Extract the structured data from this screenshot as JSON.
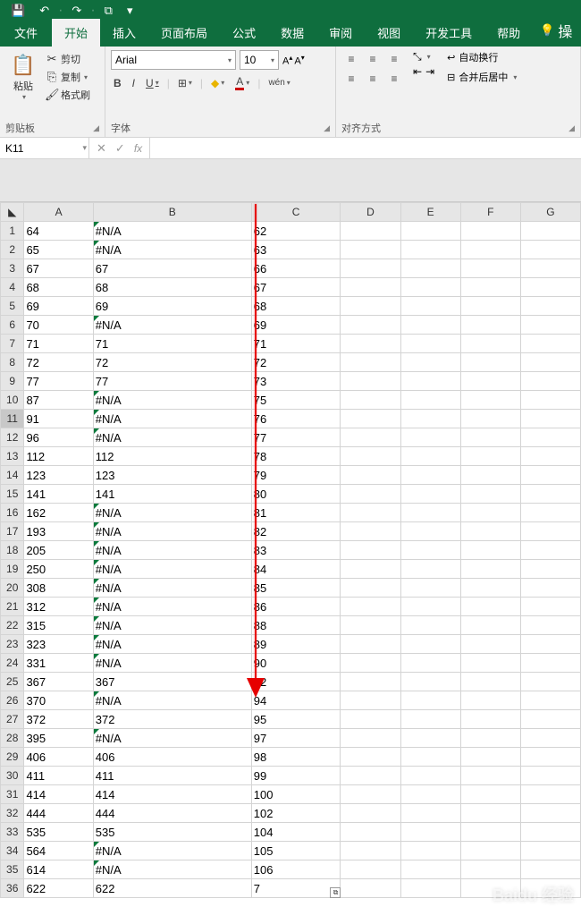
{
  "qat": {
    "save": "💾",
    "undo": "↶",
    "redo": "↷",
    "touch": "⧉"
  },
  "tabs": {
    "file": "文件",
    "items": [
      "开始",
      "插入",
      "页面布局",
      "公式",
      "数据",
      "审阅",
      "视图",
      "开发工具",
      "帮助"
    ],
    "active": "开始",
    "tellme_icon": "💡",
    "tellme": "操"
  },
  "ribbon": {
    "clipboard": {
      "paste": "粘贴",
      "cut": "剪切",
      "copy": "复制",
      "painter": "格式刷",
      "label": "剪贴板"
    },
    "font": {
      "name": "Arial",
      "size": "10",
      "inc": "A↑",
      "dec": "A↓",
      "bold": "B",
      "italic": "I",
      "underline": "U",
      "border": "⊞",
      "fill": "◆",
      "color": "A",
      "phonetic": "wén",
      "label": "字体"
    },
    "align": {
      "wrap": "自动换行",
      "merge": "合并后居中",
      "label": "对齐方式"
    }
  },
  "nameBox": "K11",
  "formula": "",
  "columns": [
    "A",
    "B",
    "C",
    "D",
    "E",
    "F",
    "G"
  ],
  "rows": [
    {
      "n": 1,
      "A": "64",
      "B": "#N/A",
      "C": "62"
    },
    {
      "n": 2,
      "A": "65",
      "B": "#N/A",
      "C": "63"
    },
    {
      "n": 3,
      "A": "67",
      "B": "67",
      "C": "66"
    },
    {
      "n": 4,
      "A": "68",
      "B": "68",
      "C": "67"
    },
    {
      "n": 5,
      "A": "69",
      "B": "69",
      "C": "68"
    },
    {
      "n": 6,
      "A": "70",
      "B": "#N/A",
      "C": "69"
    },
    {
      "n": 7,
      "A": "71",
      "B": "71",
      "C": "71"
    },
    {
      "n": 8,
      "A": "72",
      "B": "72",
      "C": "72"
    },
    {
      "n": 9,
      "A": "77",
      "B": "77",
      "C": "73"
    },
    {
      "n": 10,
      "A": "87",
      "B": "#N/A",
      "C": "75"
    },
    {
      "n": 11,
      "A": "91",
      "B": "#N/A",
      "C": "76"
    },
    {
      "n": 12,
      "A": "96",
      "B": "#N/A",
      "C": "77"
    },
    {
      "n": 13,
      "A": "112",
      "B": "112",
      "C": "78"
    },
    {
      "n": 14,
      "A": "123",
      "B": "123",
      "C": "79"
    },
    {
      "n": 15,
      "A": "141",
      "B": "141",
      "C": "80"
    },
    {
      "n": 16,
      "A": "162",
      "B": "#N/A",
      "C": "81"
    },
    {
      "n": 17,
      "A": "193",
      "B": "#N/A",
      "C": "82"
    },
    {
      "n": 18,
      "A": "205",
      "B": "#N/A",
      "C": "83"
    },
    {
      "n": 19,
      "A": "250",
      "B": "#N/A",
      "C": "84"
    },
    {
      "n": 20,
      "A": "308",
      "B": "#N/A",
      "C": "85"
    },
    {
      "n": 21,
      "A": "312",
      "B": "#N/A",
      "C": "86"
    },
    {
      "n": 22,
      "A": "315",
      "B": "#N/A",
      "C": "88"
    },
    {
      "n": 23,
      "A": "323",
      "B": "#N/A",
      "C": "89"
    },
    {
      "n": 24,
      "A": "331",
      "B": "#N/A",
      "C": "90"
    },
    {
      "n": 25,
      "A": "367",
      "B": "367",
      "C": "92"
    },
    {
      "n": 26,
      "A": "370",
      "B": "#N/A",
      "C": "94"
    },
    {
      "n": 27,
      "A": "372",
      "B": "372",
      "C": "95"
    },
    {
      "n": 28,
      "A": "395",
      "B": "#N/A",
      "C": "97"
    },
    {
      "n": 29,
      "A": "406",
      "B": "406",
      "C": "98"
    },
    {
      "n": 30,
      "A": "411",
      "B": "411",
      "C": "99"
    },
    {
      "n": 31,
      "A": "414",
      "B": "414",
      "C": "100"
    },
    {
      "n": 32,
      "A": "444",
      "B": "444",
      "C": "102"
    },
    {
      "n": 33,
      "A": "535",
      "B": "535",
      "C": "104"
    },
    {
      "n": 34,
      "A": "564",
      "B": "#N/A",
      "C": "105"
    },
    {
      "n": 35,
      "A": "614",
      "B": "#N/A",
      "C": "106"
    },
    {
      "n": 36,
      "A": "622",
      "B": "622",
      "C": "7"
    }
  ],
  "selectedRow": 11,
  "autofillText": "⧉",
  "watermark": "Baidu 经验"
}
